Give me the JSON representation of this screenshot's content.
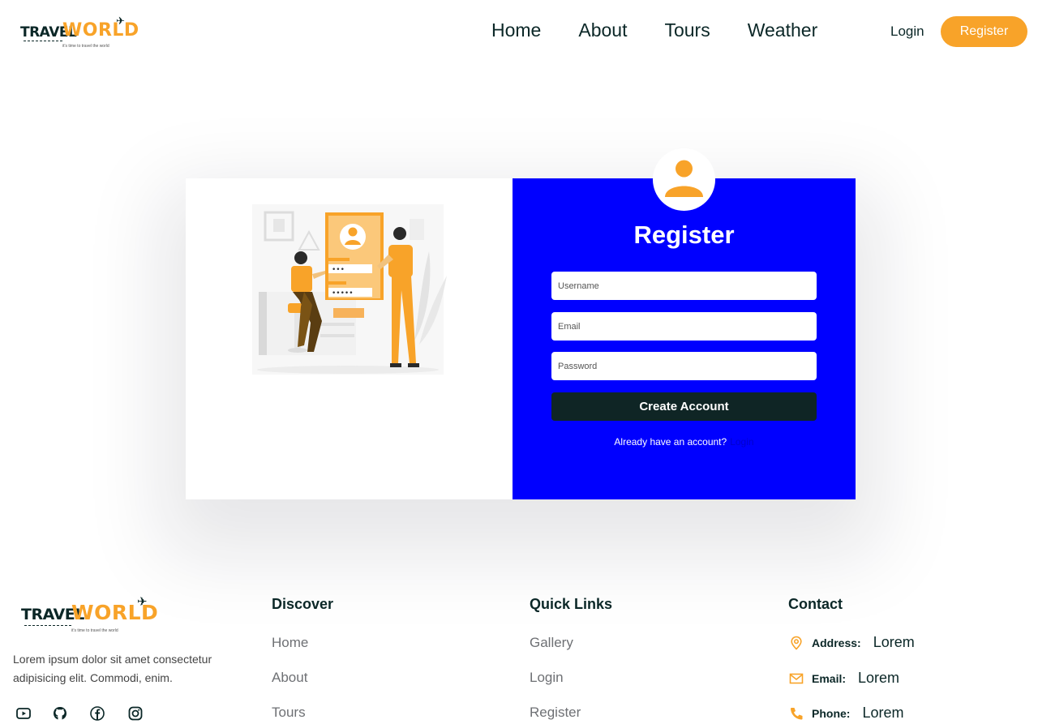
{
  "brand": {
    "name_part1": "TRAVEL",
    "name_part2": "WORLD",
    "tagline": "it's time to travel the world"
  },
  "nav": {
    "items": [
      "Home",
      "About",
      "Tours",
      "Weather"
    ],
    "login": "Login",
    "register": "Register"
  },
  "colors": {
    "accent": "#f8a329",
    "form_bg": "#0000ff",
    "dark": "#0f2525"
  },
  "form": {
    "title": "Register",
    "username_placeholder": "Username",
    "email_placeholder": "Email",
    "password_placeholder": "Password",
    "submit": "Create Account",
    "already_text": "Already have an account?",
    "login_link": "Login"
  },
  "footer": {
    "description": "Lorem ipsum dolor sit amet consectetur adipisicing elit. Commodi, enim.",
    "social_icons": [
      "youtube-icon",
      "github-icon",
      "facebook-icon",
      "instagram-icon"
    ],
    "discover": {
      "title": "Discover",
      "links": [
        "Home",
        "About",
        "Tours"
      ]
    },
    "quick_links": {
      "title": "Quick Links",
      "links": [
        "Gallery",
        "Login",
        "Register"
      ]
    },
    "contact": {
      "title": "Contact",
      "address_label": "Address:",
      "address_value": "Lorem",
      "email_label": "Email:",
      "email_value": "Lorem",
      "phone_label": "Phone:",
      "phone_value": "Lorem"
    }
  }
}
